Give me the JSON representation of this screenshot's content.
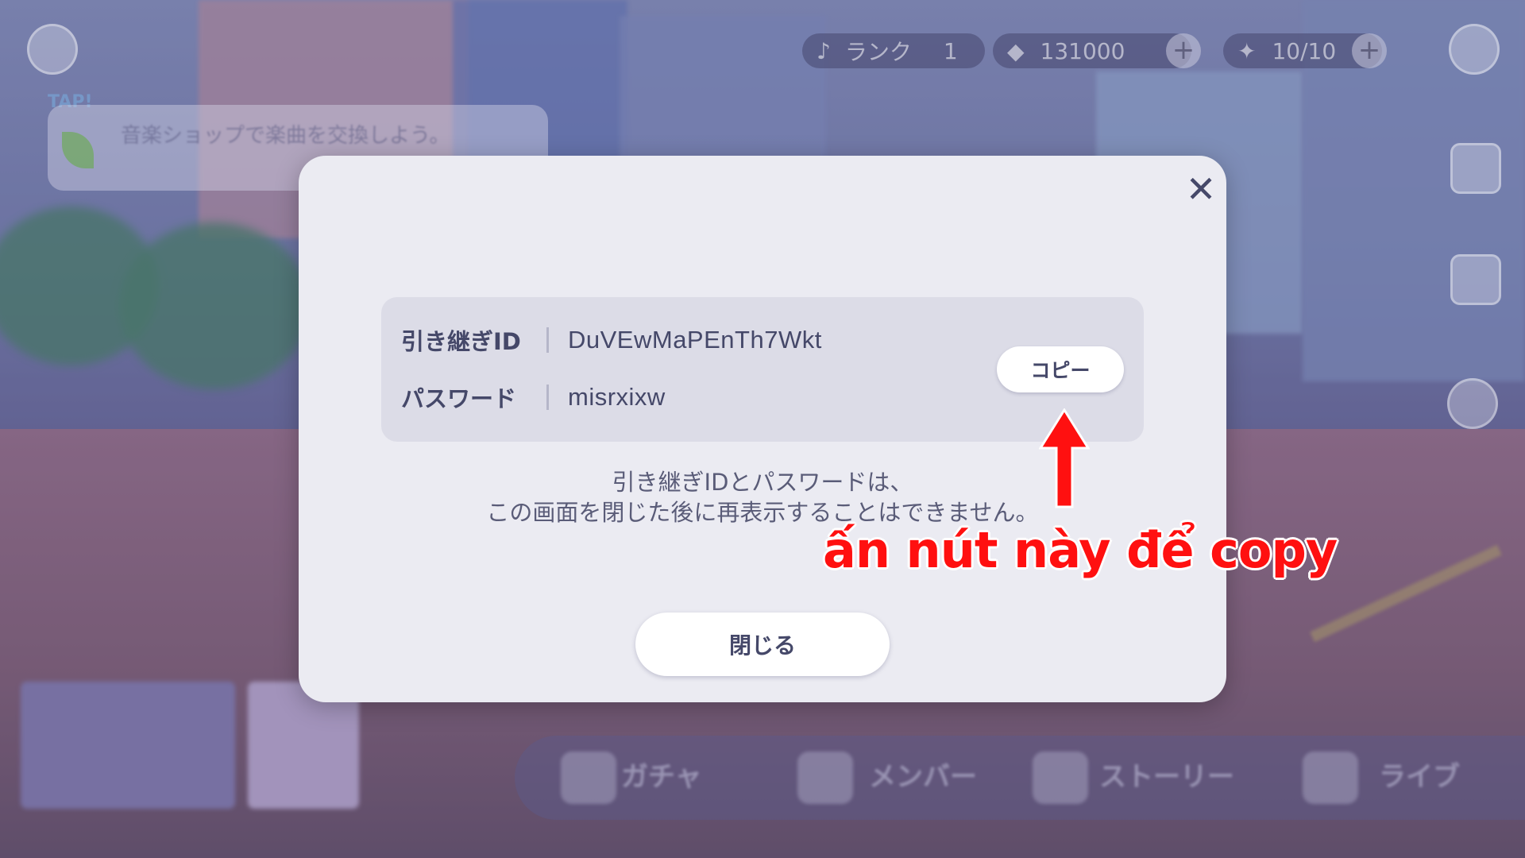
{
  "hud": {
    "rank_label": "ランク",
    "rank_value": "1",
    "crystal_value": "131000",
    "energy_value": "10/10",
    "hint_text": "音楽ショップで楽曲を交換しよう。",
    "tap_label": "TAP!"
  },
  "nav": {
    "gacha": "ガチャ",
    "member": "メンバー",
    "story": "ストーリー",
    "live": "ライブ"
  },
  "dialog": {
    "id_label": "引き継ぎID",
    "id_value": "DuVEwMaPEnTh7Wkt",
    "password_label": "パスワード",
    "password_value": "misrxixw",
    "copy_label": "コピー",
    "notice_line1": "引き継ぎIDとパスワードは、",
    "notice_line2": "この画面を閉じた後に再表示することはできません。",
    "close_label": "閉じる",
    "close_icon": "✕"
  },
  "annotation": {
    "text": "ấn nút này để copy",
    "color": "#ff1010"
  }
}
